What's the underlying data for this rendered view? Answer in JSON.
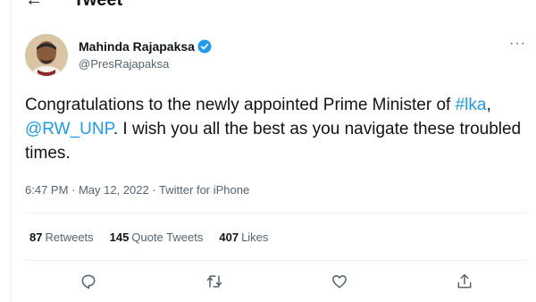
{
  "header": {
    "title": "Tweet",
    "back_icon": "arrow-left-icon"
  },
  "tweet": {
    "author_name": "Mahinda Rajapaksa",
    "author_handle": "@PresRajapaksa",
    "verified_icon": "verified-badge-icon",
    "more_label": "···",
    "text_parts": {
      "p1": "Congratulations to the newly appointed Prime Minister of ",
      "hashtag": "#lka",
      "p2": ", ",
      "mention": "@RW_UNP",
      "p3": ". I wish you all the best as you navigate these troubled times."
    },
    "timestamp": "6:47 PM · May 12, 2022 · Twitter for iPhone"
  },
  "stats": {
    "retweets_count": "87",
    "retweets_label": "Retweets",
    "quote_count": "145",
    "quote_label": "Quote Tweets",
    "likes_count": "407",
    "likes_label": "Likes"
  },
  "actions": [
    "reply-icon",
    "retweet-icon",
    "like-icon",
    "share-icon"
  ],
  "colors": {
    "link": "#1d9bf0",
    "secondary_text": "#536471",
    "divider": "#eff3f4"
  }
}
